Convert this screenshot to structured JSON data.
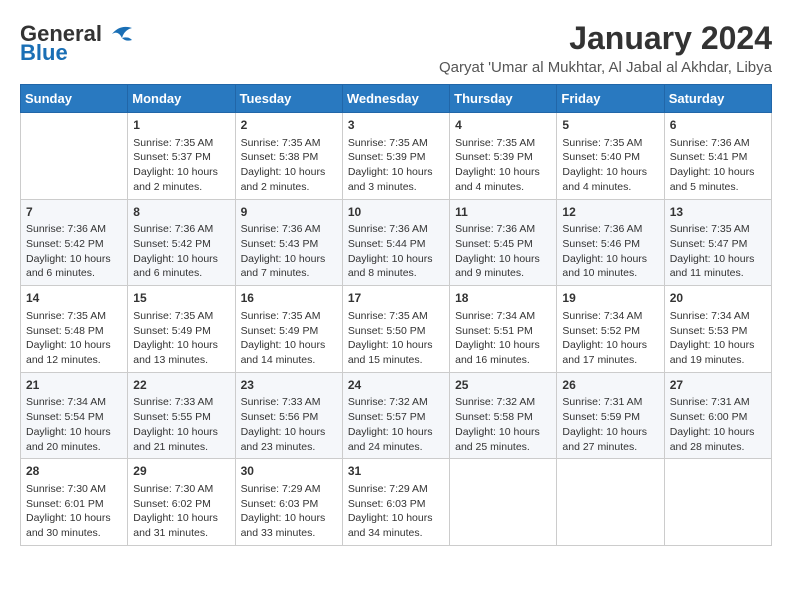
{
  "header": {
    "logo_line1": "General",
    "logo_line2": "Blue",
    "main_title": "January 2024",
    "subtitle": "Qaryat 'Umar al Mukhtar, Al Jabal al Akhdar, Libya"
  },
  "weekdays": [
    "Sunday",
    "Monday",
    "Tuesday",
    "Wednesday",
    "Thursday",
    "Friday",
    "Saturday"
  ],
  "weeks": [
    {
      "days": [
        {
          "num": "",
          "info": ""
        },
        {
          "num": "1",
          "info": "Sunrise: 7:35 AM\nSunset: 5:37 PM\nDaylight: 10 hours\nand 2 minutes."
        },
        {
          "num": "2",
          "info": "Sunrise: 7:35 AM\nSunset: 5:38 PM\nDaylight: 10 hours\nand 2 minutes."
        },
        {
          "num": "3",
          "info": "Sunrise: 7:35 AM\nSunset: 5:39 PM\nDaylight: 10 hours\nand 3 minutes."
        },
        {
          "num": "4",
          "info": "Sunrise: 7:35 AM\nSunset: 5:39 PM\nDaylight: 10 hours\nand 4 minutes."
        },
        {
          "num": "5",
          "info": "Sunrise: 7:35 AM\nSunset: 5:40 PM\nDaylight: 10 hours\nand 4 minutes."
        },
        {
          "num": "6",
          "info": "Sunrise: 7:36 AM\nSunset: 5:41 PM\nDaylight: 10 hours\nand 5 minutes."
        }
      ]
    },
    {
      "days": [
        {
          "num": "7",
          "info": "Sunrise: 7:36 AM\nSunset: 5:42 PM\nDaylight: 10 hours\nand 6 minutes."
        },
        {
          "num": "8",
          "info": "Sunrise: 7:36 AM\nSunset: 5:42 PM\nDaylight: 10 hours\nand 6 minutes."
        },
        {
          "num": "9",
          "info": "Sunrise: 7:36 AM\nSunset: 5:43 PM\nDaylight: 10 hours\nand 7 minutes."
        },
        {
          "num": "10",
          "info": "Sunrise: 7:36 AM\nSunset: 5:44 PM\nDaylight: 10 hours\nand 8 minutes."
        },
        {
          "num": "11",
          "info": "Sunrise: 7:36 AM\nSunset: 5:45 PM\nDaylight: 10 hours\nand 9 minutes."
        },
        {
          "num": "12",
          "info": "Sunrise: 7:36 AM\nSunset: 5:46 PM\nDaylight: 10 hours\nand 10 minutes."
        },
        {
          "num": "13",
          "info": "Sunrise: 7:35 AM\nSunset: 5:47 PM\nDaylight: 10 hours\nand 11 minutes."
        }
      ]
    },
    {
      "days": [
        {
          "num": "14",
          "info": "Sunrise: 7:35 AM\nSunset: 5:48 PM\nDaylight: 10 hours\nand 12 minutes."
        },
        {
          "num": "15",
          "info": "Sunrise: 7:35 AM\nSunset: 5:49 PM\nDaylight: 10 hours\nand 13 minutes."
        },
        {
          "num": "16",
          "info": "Sunrise: 7:35 AM\nSunset: 5:49 PM\nDaylight: 10 hours\nand 14 minutes."
        },
        {
          "num": "17",
          "info": "Sunrise: 7:35 AM\nSunset: 5:50 PM\nDaylight: 10 hours\nand 15 minutes."
        },
        {
          "num": "18",
          "info": "Sunrise: 7:34 AM\nSunset: 5:51 PM\nDaylight: 10 hours\nand 16 minutes."
        },
        {
          "num": "19",
          "info": "Sunrise: 7:34 AM\nSunset: 5:52 PM\nDaylight: 10 hours\nand 17 minutes."
        },
        {
          "num": "20",
          "info": "Sunrise: 7:34 AM\nSunset: 5:53 PM\nDaylight: 10 hours\nand 19 minutes."
        }
      ]
    },
    {
      "days": [
        {
          "num": "21",
          "info": "Sunrise: 7:34 AM\nSunset: 5:54 PM\nDaylight: 10 hours\nand 20 minutes."
        },
        {
          "num": "22",
          "info": "Sunrise: 7:33 AM\nSunset: 5:55 PM\nDaylight: 10 hours\nand 21 minutes."
        },
        {
          "num": "23",
          "info": "Sunrise: 7:33 AM\nSunset: 5:56 PM\nDaylight: 10 hours\nand 23 minutes."
        },
        {
          "num": "24",
          "info": "Sunrise: 7:32 AM\nSunset: 5:57 PM\nDaylight: 10 hours\nand 24 minutes."
        },
        {
          "num": "25",
          "info": "Sunrise: 7:32 AM\nSunset: 5:58 PM\nDaylight: 10 hours\nand 25 minutes."
        },
        {
          "num": "26",
          "info": "Sunrise: 7:31 AM\nSunset: 5:59 PM\nDaylight: 10 hours\nand 27 minutes."
        },
        {
          "num": "27",
          "info": "Sunrise: 7:31 AM\nSunset: 6:00 PM\nDaylight: 10 hours\nand 28 minutes."
        }
      ]
    },
    {
      "days": [
        {
          "num": "28",
          "info": "Sunrise: 7:30 AM\nSunset: 6:01 PM\nDaylight: 10 hours\nand 30 minutes."
        },
        {
          "num": "29",
          "info": "Sunrise: 7:30 AM\nSunset: 6:02 PM\nDaylight: 10 hours\nand 31 minutes."
        },
        {
          "num": "30",
          "info": "Sunrise: 7:29 AM\nSunset: 6:03 PM\nDaylight: 10 hours\nand 33 minutes."
        },
        {
          "num": "31",
          "info": "Sunrise: 7:29 AM\nSunset: 6:03 PM\nDaylight: 10 hours\nand 34 minutes."
        },
        {
          "num": "",
          "info": ""
        },
        {
          "num": "",
          "info": ""
        },
        {
          "num": "",
          "info": ""
        }
      ]
    }
  ]
}
